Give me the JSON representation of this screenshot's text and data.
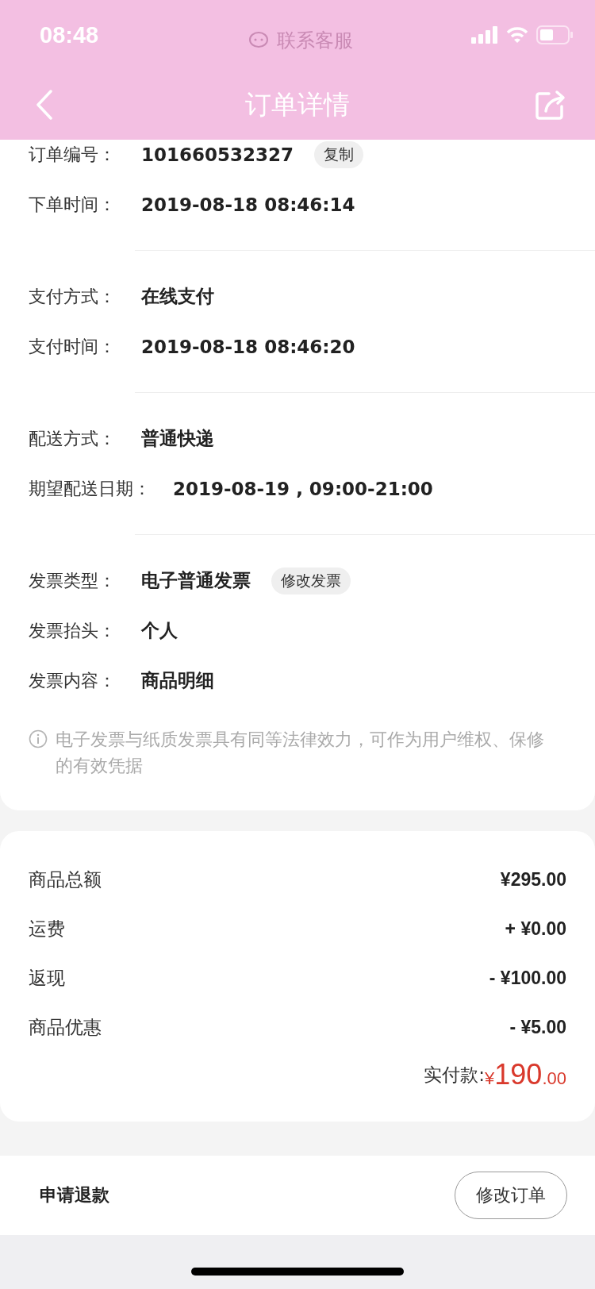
{
  "status_bar": {
    "time": "08:48",
    "hint": "联系客服"
  },
  "nav": {
    "title": "订单详情"
  },
  "info_groups": [
    {
      "rows": [
        {
          "label": "订单编号：",
          "value": "101660532327",
          "tag": "复制"
        },
        {
          "label": "下单时间：",
          "value": "2019-08-18 08:46:14"
        }
      ]
    },
    {
      "rows": [
        {
          "label": "支付方式：",
          "value": "在线支付"
        },
        {
          "label": "支付时间：",
          "value": "2019-08-18 08:46:20"
        }
      ]
    },
    {
      "rows": [
        {
          "label": "配送方式：",
          "value": "普通快递"
        },
        {
          "label": "期望配送日期：",
          "value": "2019-08-19 , 09:00-21:00"
        }
      ]
    },
    {
      "rows": [
        {
          "label": "发票类型：",
          "value": "电子普通发票",
          "tag": "修改发票"
        },
        {
          "label": "发票抬头：",
          "value": "个人"
        },
        {
          "label": "发票内容：",
          "value": "商品明细"
        }
      ]
    }
  ],
  "invoice_note": "电子发票与纸质发票具有同等法律效力，可作为用户维权、保修的有效凭据",
  "summary": {
    "rows": [
      {
        "label": "商品总额",
        "value": "¥295.00"
      },
      {
        "label": "运费",
        "value": "+ ¥0.00"
      },
      {
        "label": "返现",
        "value": "- ¥100.00"
      },
      {
        "label": "商品优惠",
        "value": "- ¥5.00"
      }
    ],
    "total": {
      "label": "实付款:",
      "currency": "¥",
      "integer": "190",
      "decimals": ".00"
    }
  },
  "bottom_bar": {
    "link": "申请退款",
    "button": "修改订单"
  }
}
